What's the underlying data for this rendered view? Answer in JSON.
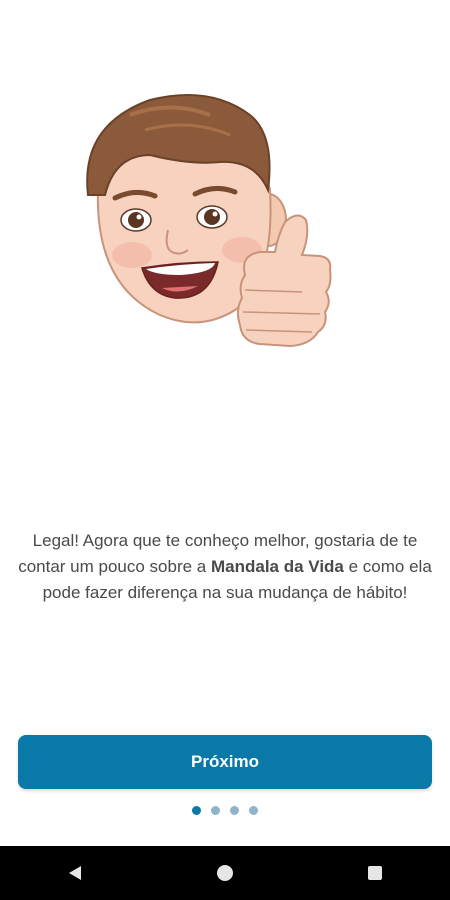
{
  "onboarding": {
    "message_part1": "Legal! Agora que te conheço melhor, gostaria de te contar um pouco sobre a ",
    "message_bold": "Mandala da Vida",
    "message_part2": " e como ela pode fazer diferença na sua mudança de hábito!",
    "next_label": "Próximo",
    "page_indicator": {
      "total": 4,
      "current": 1
    }
  },
  "nav": {
    "back_icon": "triangle-back-icon",
    "home_icon": "circle-home-icon",
    "recents_icon": "square-recents-icon"
  },
  "colors": {
    "accent": "#0b79a8",
    "dot_inactive": "#8fb3c9",
    "text": "#4a4a4a"
  }
}
